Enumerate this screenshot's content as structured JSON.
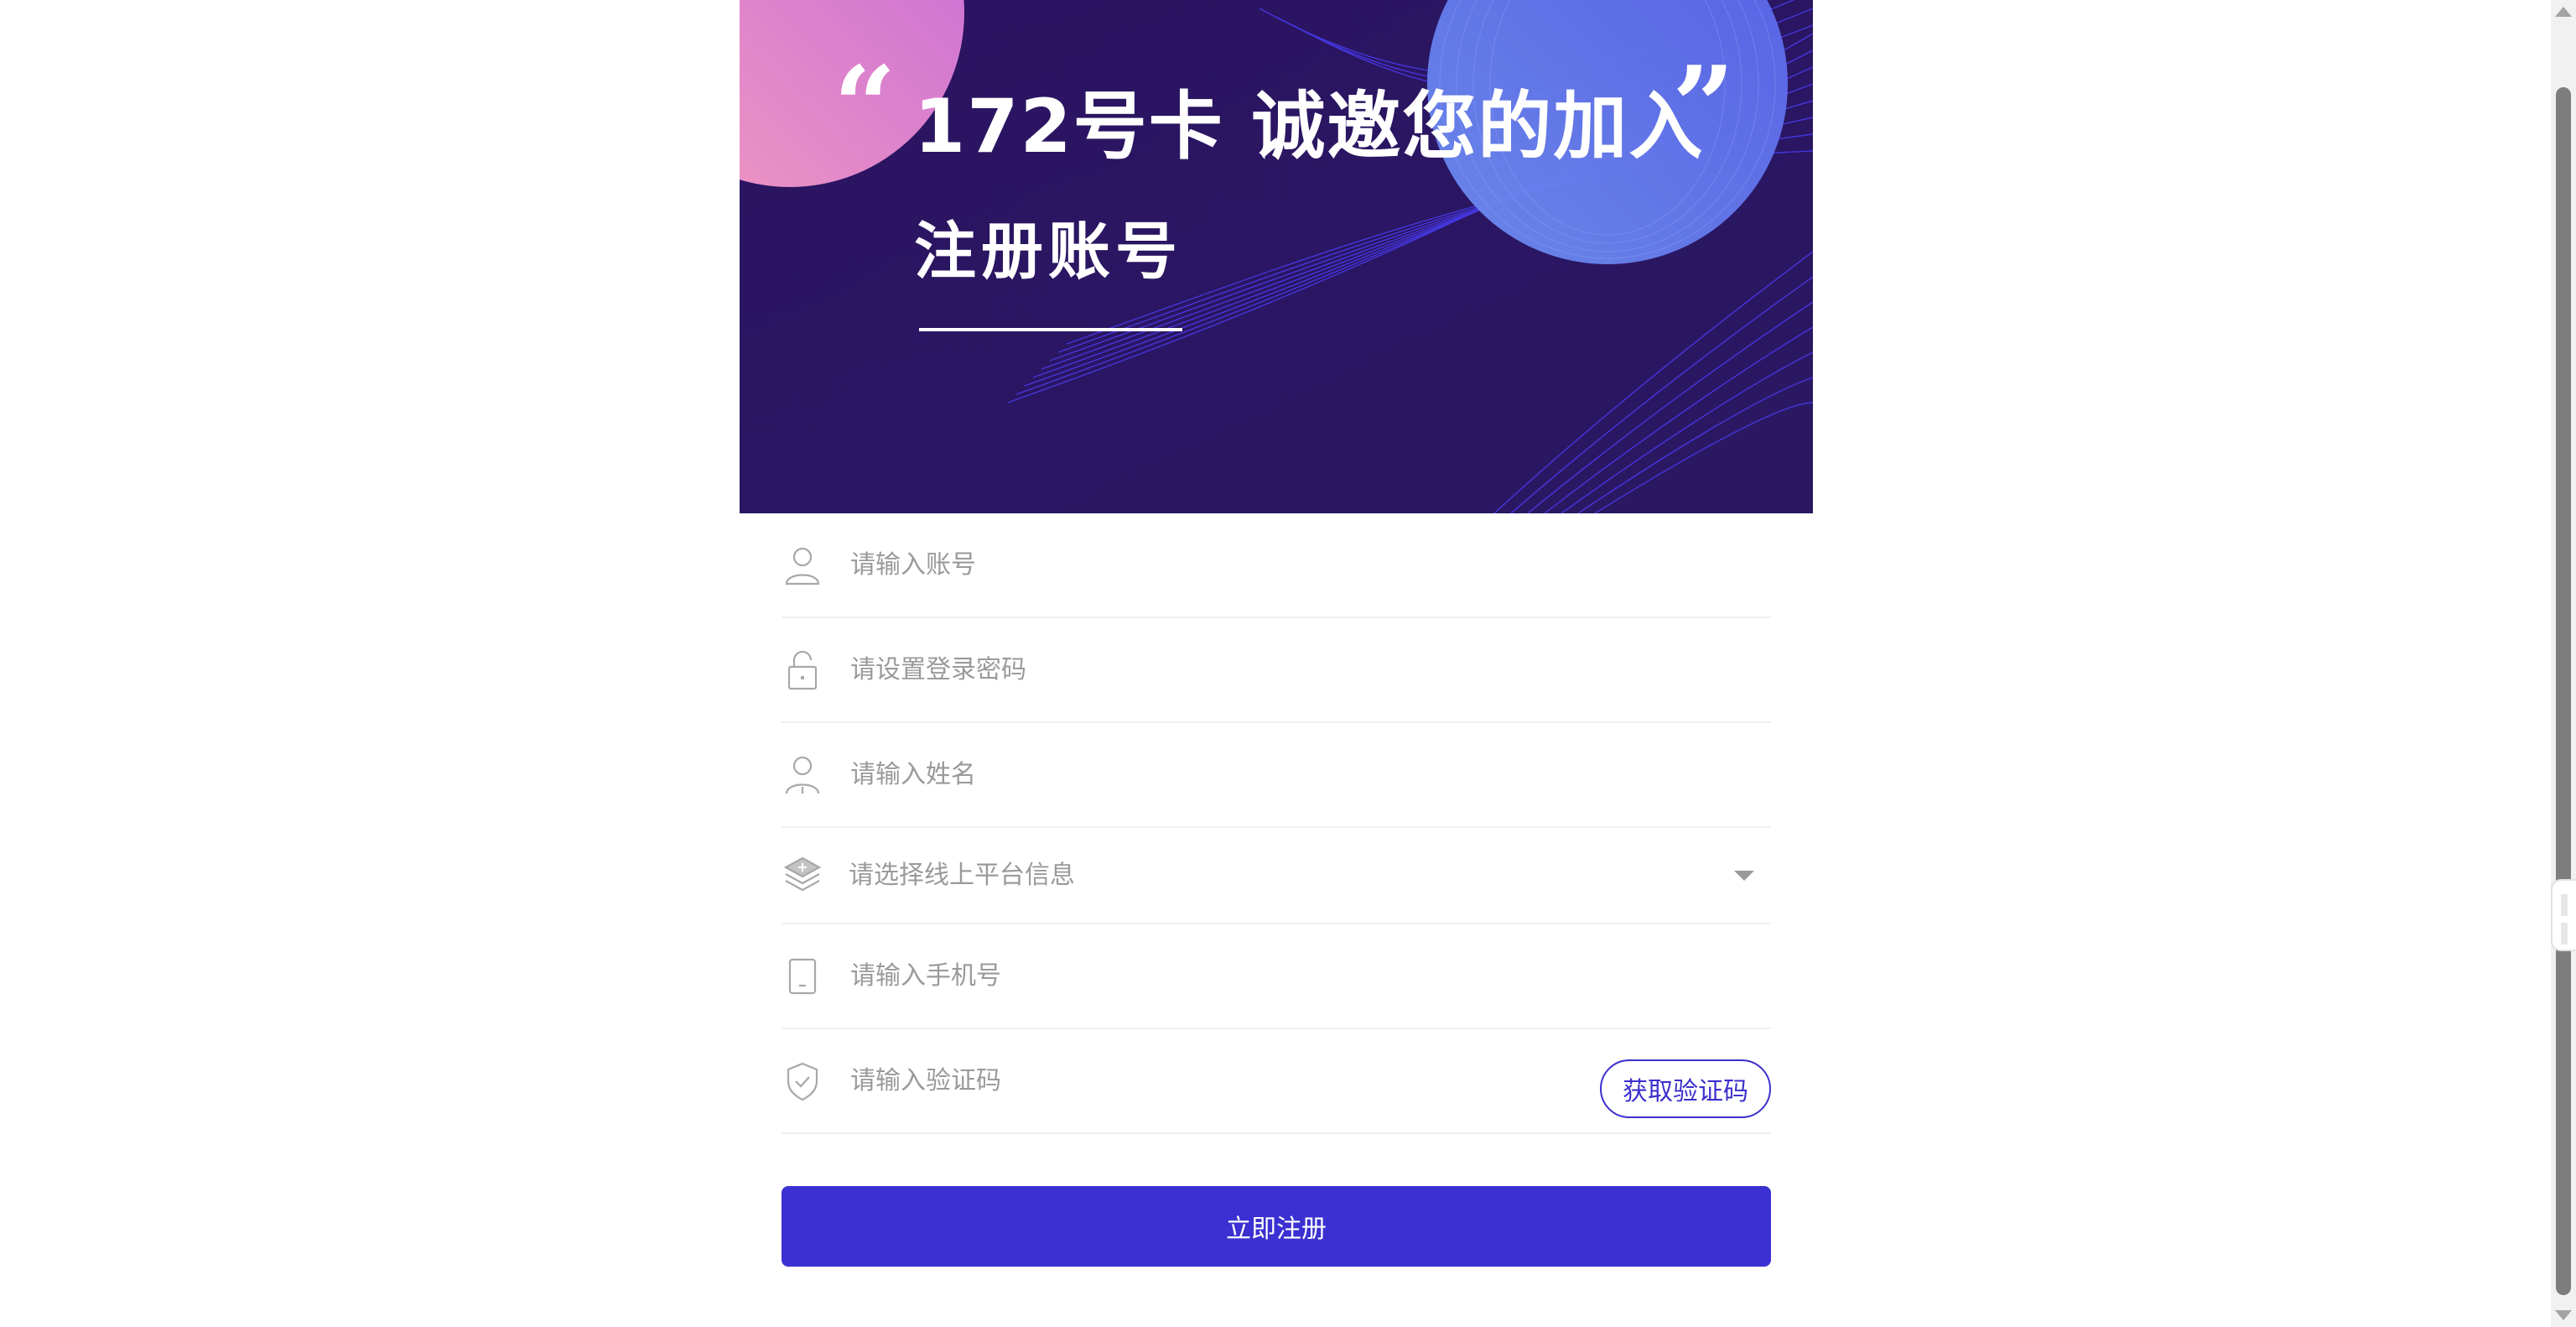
{
  "banner": {
    "title": "172号卡 诚邀您的加入",
    "subtitle": "注册账号",
    "quote_open": "“",
    "quote_close": "”",
    "colors": {
      "bg": "#2a1460",
      "accent": "#4d3ff0",
      "pink": "#f08fc0"
    }
  },
  "form": {
    "fields": [
      {
        "icon": "user-icon",
        "placeholder": "请输入账号"
      },
      {
        "icon": "unlock-icon",
        "placeholder": "请设置登录密码"
      },
      {
        "icon": "person-icon",
        "placeholder": "请输入姓名"
      },
      {
        "icon": "layers-icon",
        "placeholder": "请选择线上平台信息"
      },
      {
        "icon": "phone-icon",
        "placeholder": "请输入手机号"
      },
      {
        "icon": "shield-check-icon",
        "placeholder": "请输入验证码"
      }
    ],
    "get_code_label": "获取验证码",
    "submit_label": "立即注册",
    "accent_color": "#3b30d1"
  }
}
